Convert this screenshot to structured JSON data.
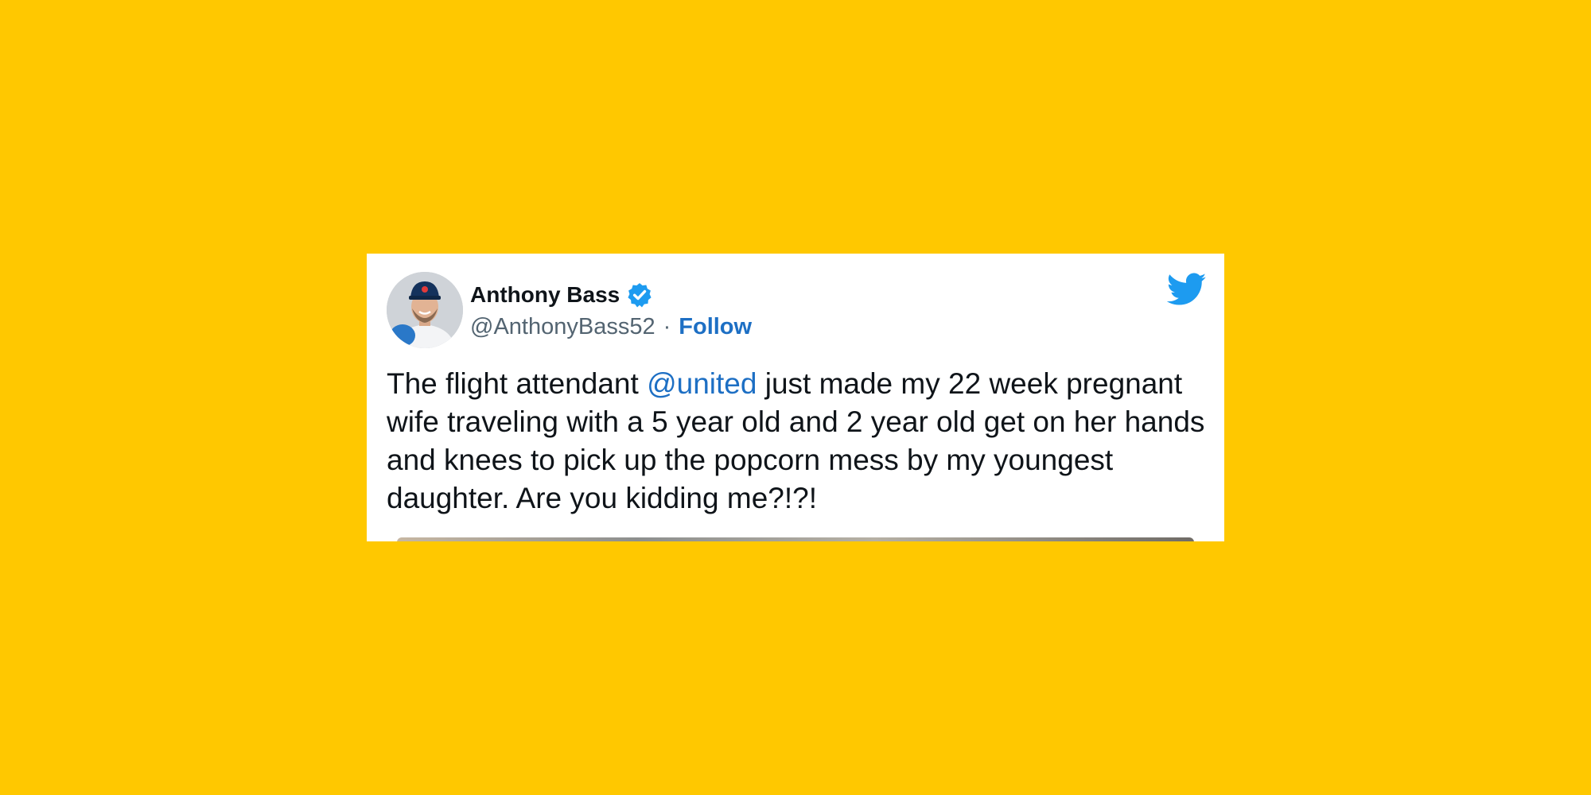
{
  "tweet": {
    "author_name": "Anthony Bass",
    "author_handle": "@AnthonyBass52",
    "separator": "·",
    "follow_label": "Follow",
    "verified": true,
    "text_before_mention": "The flight attendant ",
    "mention": "@united",
    "text_after_mention": " just made my 22 week pregnant wife traveling with a 5 year old and 2 year old get on her hands and knees to pick up the popcorn mess by my youngest daughter. Are you kidding me?!?!"
  },
  "icons": {
    "avatar": "avatar-photo",
    "verified": "verified-badge-icon",
    "brand": "twitter-bird-icon"
  },
  "colors": {
    "background": "#FFC800",
    "card": "#ffffff",
    "link": "#1d6fc4",
    "twitter_blue": "#1d9bf0",
    "text": "#0f1419",
    "muted": "#536471"
  }
}
